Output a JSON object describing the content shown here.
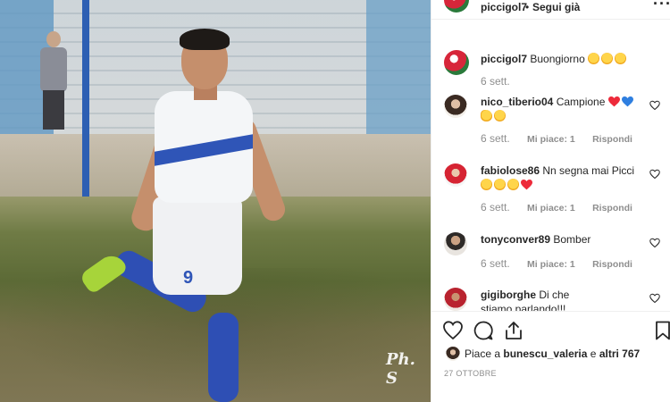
{
  "post": {
    "photo": {
      "watermark": "Ph. S",
      "jersey_number": "9"
    },
    "header": {
      "username": "piccigol7",
      "separator": "•",
      "follow_status": "Segui già",
      "more_icon": "more-horizontal-icon"
    },
    "comments": [
      {
        "username": "piccigol7",
        "text": "Buongiorno",
        "emojis": [
          "grinning-face",
          "grinning-face",
          "winking-tongue-face"
        ],
        "time": "6 sett.",
        "likes": "",
        "reply": ""
      },
      {
        "username": "nico_tiberio04",
        "text": "Campione",
        "emojis": [
          "red-heart",
          "blue-heart",
          "flexed-biceps",
          "winking-tongue-face"
        ],
        "time": "6 sett.",
        "likes": "Mi piace: 1",
        "reply": "Rispondi"
      },
      {
        "username": "fabiolose86",
        "text": "Nn segna mai Picci",
        "emojis": [
          "thinking-face",
          "rolling-laughing-face",
          "rolling-laughing-face",
          "red-heart"
        ],
        "time": "6 sett.",
        "likes": "Mi piace: 1",
        "reply": "Rispondi"
      },
      {
        "username": "tonyconver89",
        "text": "Bomber",
        "emojis": [],
        "time": "6 sett.",
        "likes": "Mi piace: 1",
        "reply": "Rispondi"
      },
      {
        "username": "gigiborghe",
        "text": "Di che stiamo parlando!!!",
        "emojis": [],
        "time": "",
        "likes": "",
        "reply": ""
      }
    ],
    "actions": {
      "like_icon": "heart-outline-icon",
      "comment_icon": "comment-bubble-icon",
      "share_icon": "share-upload-icon",
      "save_icon": "bookmark-icon"
    },
    "likes_summary": {
      "prefix": "Piace a",
      "user": "bunescu_valeria",
      "connector": "e",
      "others": "altri 767"
    },
    "date": "27 OTTOBRE"
  },
  "colors": {
    "text_primary": "#262626",
    "text_secondary": "#8e8e8e",
    "divider": "#efefef",
    "heart_red": "#ed4956",
    "heart_blue": "#3897f0",
    "jersey_blue": "#2f55b7"
  }
}
